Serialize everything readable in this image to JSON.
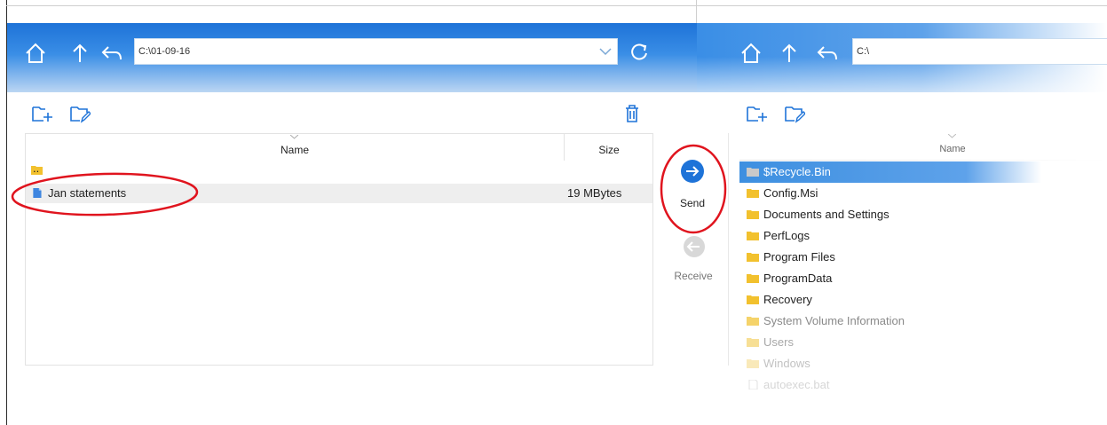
{
  "left_pane": {
    "path": "C:\\01-09-16",
    "columns": {
      "name": "Name",
      "size": "Size"
    },
    "rows": [
      {
        "name": "..",
        "size": "",
        "type": "folder"
      },
      {
        "name": "Jan statements",
        "size": "19 MBytes",
        "type": "file"
      }
    ]
  },
  "transfer": {
    "send_label": "Send",
    "receive_label": "Receive"
  },
  "right_pane": {
    "path": "C:\\",
    "columns": {
      "name": "Name"
    },
    "rows": [
      {
        "name": "$Recycle.Bin",
        "type": "folder",
        "selected": true
      },
      {
        "name": "Config.Msi",
        "type": "folder"
      },
      {
        "name": "Documents and Settings",
        "type": "folder"
      },
      {
        "name": "PerfLogs",
        "type": "folder"
      },
      {
        "name": "Program Files",
        "type": "folder"
      },
      {
        "name": "ProgramData",
        "type": "folder"
      },
      {
        "name": "Recovery",
        "type": "folder"
      },
      {
        "name": "System Volume Information",
        "type": "folder",
        "dimmed": true
      },
      {
        "name": "Users",
        "type": "folder",
        "dimmed": true
      },
      {
        "name": "Windows",
        "type": "folder",
        "dimmed": true
      },
      {
        "name": "autoexec.bat",
        "type": "file",
        "dimmed": true
      }
    ]
  },
  "icons": {
    "home": "home-icon",
    "up": "arrow-up-icon",
    "back": "back-icon",
    "refresh": "refresh-icon",
    "new_folder": "new-folder-icon",
    "rename": "rename-folder-icon",
    "delete": "trash-icon",
    "send": "arrow-right-circle-icon",
    "receive": "arrow-left-circle-icon"
  },
  "colors": {
    "accent": "#1e73d8",
    "folder": "#f2c12e",
    "selection": "#3d8fe0",
    "annotation": "#e0141e"
  }
}
